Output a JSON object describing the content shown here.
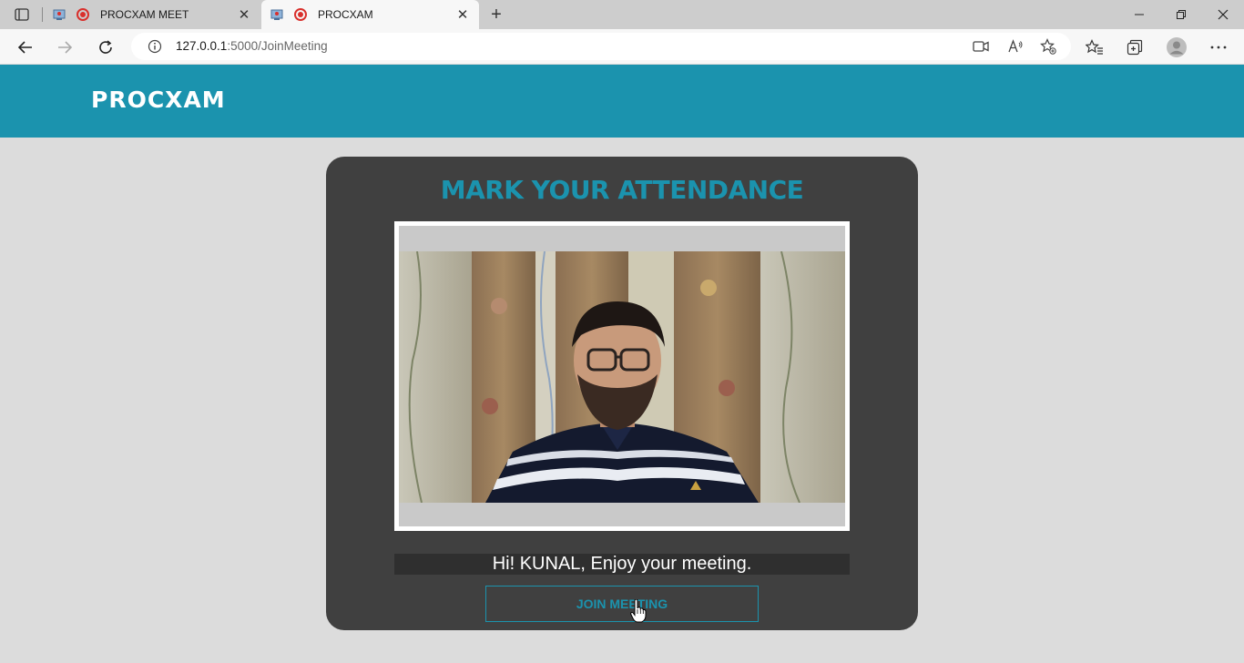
{
  "browser": {
    "tabs": [
      {
        "title": "PROCXAM MEET",
        "active": false
      },
      {
        "title": "PROCXAM",
        "active": true
      }
    ],
    "url_host": "127.0.0.1",
    "url_path": ":5000/JoinMeeting"
  },
  "site": {
    "brand": "PROCXAM",
    "brand_color": "#1b93ae"
  },
  "attendance": {
    "title": "MARK YOUR ATTENDANCE",
    "greeting": "Hi! KUNAL, Enjoy your meeting.",
    "join_label": "JOIN MEETING"
  }
}
